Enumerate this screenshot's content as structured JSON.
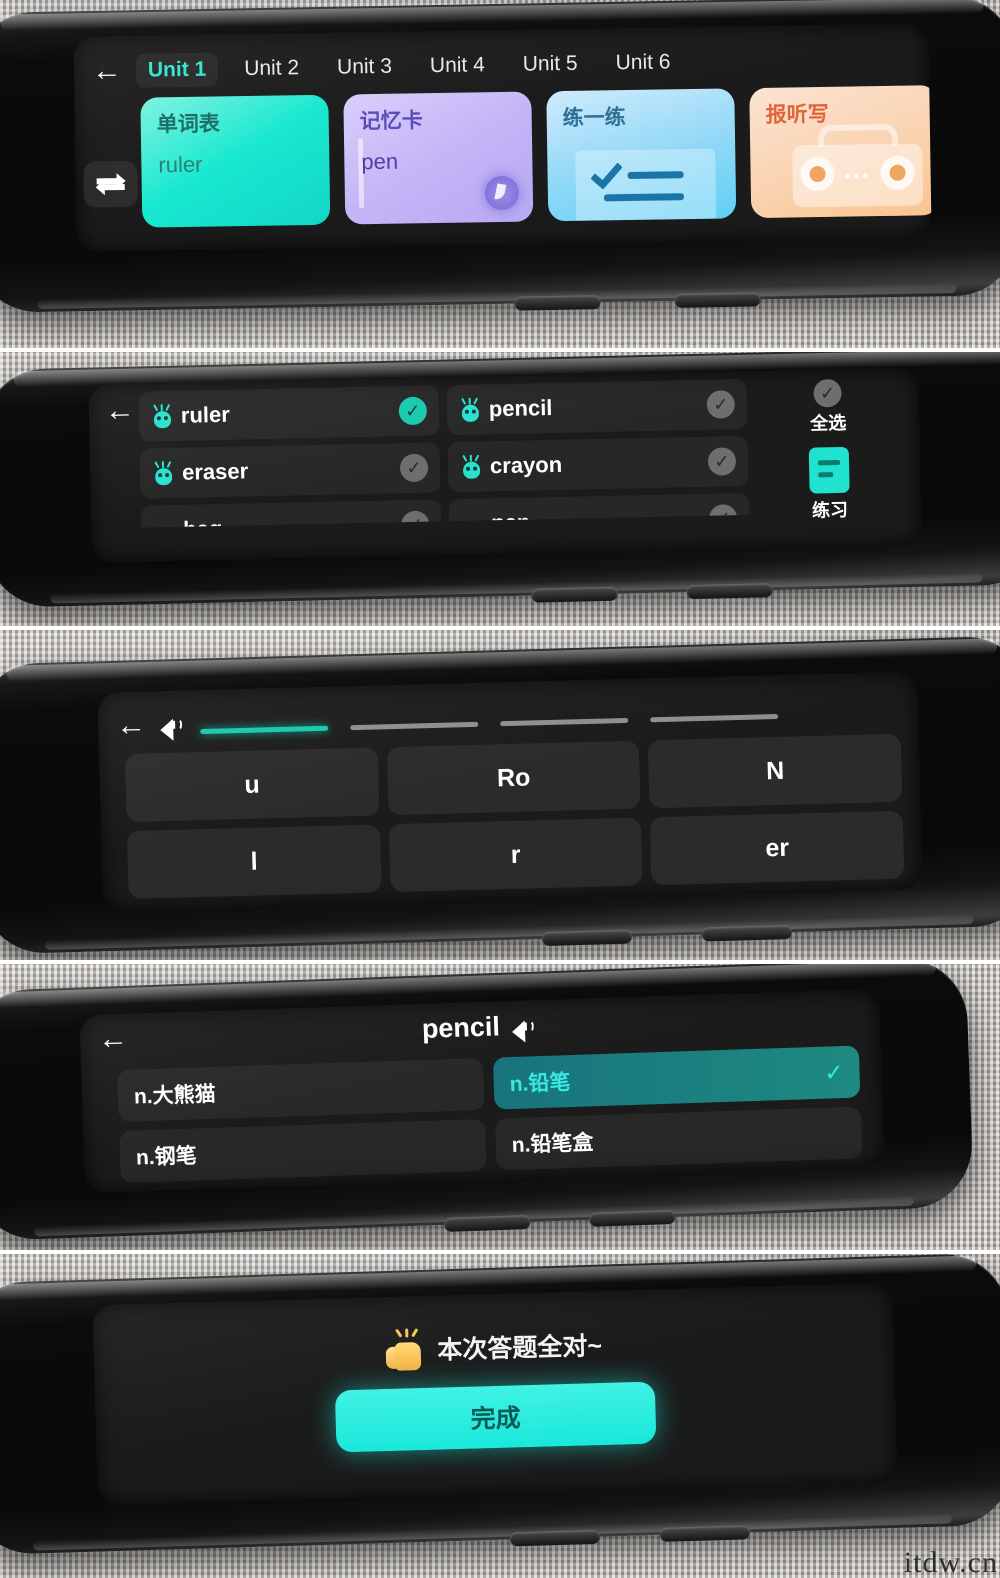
{
  "device": {
    "name": "dictionary-pen",
    "watermark": "itdw.cn"
  },
  "panel1": {
    "back_label": "←",
    "swap_icon": "swap-arrows-icon",
    "tabs": [
      {
        "label": "Unit 1",
        "active": true
      },
      {
        "label": "Unit 2",
        "active": false
      },
      {
        "label": "Unit 3",
        "active": false
      },
      {
        "label": "Unit 4",
        "active": false
      },
      {
        "label": "Unit 5",
        "active": false
      },
      {
        "label": "Unit 6",
        "active": false
      }
    ],
    "cards": [
      {
        "title": "单词表",
        "word": "ruler",
        "icon": "none"
      },
      {
        "title": "记忆卡",
        "word": "pen",
        "icon": "memory-card-icon"
      },
      {
        "title": "练一练",
        "word": "",
        "icon": "checklist-icon"
      },
      {
        "title": "报听写",
        "word": "",
        "icon": "radio-icon"
      }
    ]
  },
  "panel2": {
    "back_label": "←",
    "rows": [
      [
        {
          "word": "ruler",
          "checked": true
        },
        {
          "word": "pencil",
          "checked": false
        }
      ],
      [
        {
          "word": "eraser",
          "checked": false
        },
        {
          "word": "crayon",
          "checked": false
        }
      ],
      [
        {
          "word": "bag",
          "checked": false
        },
        {
          "word": "pen",
          "checked": false
        }
      ]
    ],
    "select_all_label": "全选",
    "practice_label": "练习"
  },
  "panel3": {
    "back_label": "←",
    "speaker_icon": "speaker-icon",
    "blanks": [
      true,
      false,
      false,
      false
    ],
    "keys": [
      [
        "u",
        "Ro",
        "N"
      ],
      [
        "l",
        "r",
        "er"
      ]
    ]
  },
  "panel4": {
    "back_label": "←",
    "word": "pencil",
    "speaker_icon": "speaker-icon",
    "options": [
      {
        "text": "n.大熊猫",
        "selected": false
      },
      {
        "text": "n.铅笔",
        "selected": true
      },
      {
        "text": "n.钢笔",
        "selected": false
      },
      {
        "text": "n.铅笔盒",
        "selected": false
      }
    ],
    "tick": "✓"
  },
  "panel5": {
    "icon": "thumbs-up-icon",
    "message": "本次答题全对~",
    "done_label": "完成"
  },
  "colors": {
    "accent_cyan": "#19e8da",
    "accent_teal": "#2fe6cf",
    "card_wordlist": "#18e8d0",
    "card_memory": "#c2b4f6",
    "card_practice": "#8fd8f7",
    "card_dictation": "#fad3b0",
    "screen_bg": "#1b1b1b"
  }
}
